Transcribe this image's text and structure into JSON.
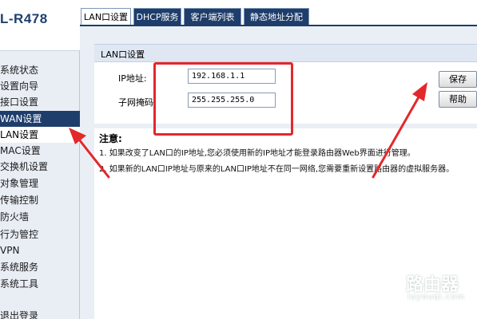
{
  "brand": "L-R478",
  "sidebar": {
    "items": [
      {
        "label": "系统状态"
      },
      {
        "label": "设置向导"
      },
      {
        "label": "接口设置"
      },
      {
        "label": "WAN设置"
      },
      {
        "label": "LAN设置"
      },
      {
        "label": "MAC设置"
      },
      {
        "label": "交换机设置"
      },
      {
        "label": "对象管理"
      },
      {
        "label": "传输控制"
      },
      {
        "label": "防火墙"
      },
      {
        "label": "行为管控"
      },
      {
        "label": "VPN"
      },
      {
        "label": "系统服务"
      },
      {
        "label": "系统工具"
      },
      {
        "label": "退出登录"
      }
    ]
  },
  "tabs": [
    {
      "label": "LAN口设置"
    },
    {
      "label": "DHCP服务"
    },
    {
      "label": "客户端列表"
    },
    {
      "label": "静态地址分配"
    }
  ],
  "panel": {
    "title": "LAN口设置",
    "ip_label": "IP地址:",
    "ip_value": "192.168.1.1",
    "mask_label": "子网掩码",
    "mask_value": "255.255.255.0"
  },
  "buttons": {
    "save": "保存",
    "help": "帮助"
  },
  "notes": {
    "title": "注意:",
    "line1": "1. 如果改变了LAN口的IP地址,您必须使用新的IP地址才能登录路由器Web界面进行管理。",
    "line2": "2. 如果新的LAN口IP地址与原来的LAN口IP地址不在同一网络,您需要重新设置路由器的虚拟服务器。"
  },
  "watermark": {
    "text": "路由器",
    "url": "luyouqi.com"
  },
  "colors": {
    "accent_dark_blue": "#1e3d6b",
    "annotation_red": "#e3282b"
  }
}
